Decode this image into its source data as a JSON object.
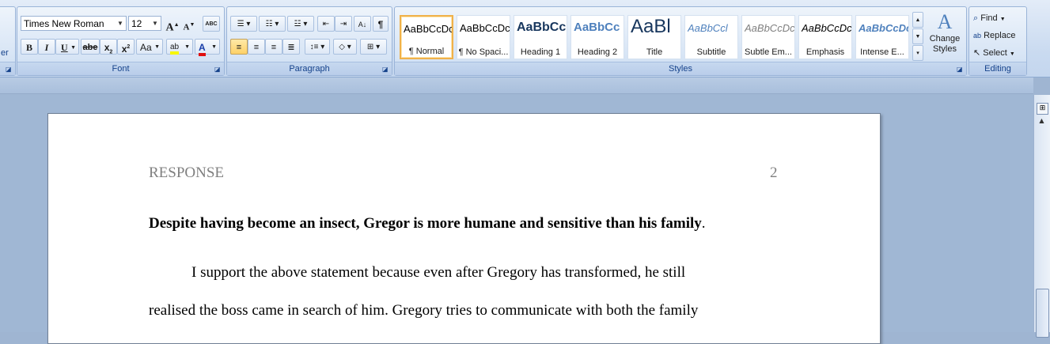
{
  "font_group": {
    "title": "Font",
    "font_name": "Times New Roman",
    "font_size": "12",
    "grow_label": "A",
    "shrink_label": "A",
    "clear_label": "ABC",
    "bold": "B",
    "italic": "I",
    "underline": "U",
    "strike": "abe",
    "subscript": "x",
    "superscript": "x",
    "change_case": "Aa",
    "highlight": "ab",
    "font_color": "A",
    "highlight_color": "#f7f700",
    "font_color_value": "#e01010"
  },
  "paragraph_group": {
    "title": "Paragraph",
    "show_marks": "¶"
  },
  "styles_group": {
    "title": "Styles",
    "tiles": [
      {
        "sample": "AaBbCcDc",
        "label": "¶ Normal",
        "selected": true
      },
      {
        "sample": "AaBbCcDc",
        "label": "¶ No Spaci..."
      },
      {
        "sample": "AaBbCc",
        "label": "Heading 1"
      },
      {
        "sample": "AaBbCc",
        "label": "Heading 2"
      },
      {
        "sample": "AaBl",
        "label": "Title"
      },
      {
        "sample": "AaBbCcl",
        "label": "Subtitle"
      },
      {
        "sample": "AaBbCcDc",
        "label": "Subtle Em..."
      },
      {
        "sample": "AaBbCcDc",
        "label": "Emphasis"
      },
      {
        "sample": "AaBbCcDc",
        "label": "Intense E..."
      }
    ],
    "change_styles": "Change Styles"
  },
  "editing_group": {
    "title": "Editing",
    "find": "Find",
    "replace": "Replace",
    "select": "Select"
  },
  "left_edge_label": "er",
  "document": {
    "header_left": "RESPONSE",
    "header_right": "2",
    "bold_sentence": "Despite having become an insect, Gregor is more humane and sensitive than his family",
    "bold_period": ".",
    "para_line1": "I support the above statement because even after Gregory has transformed, he still",
    "para_line2": "realised the boss came in search of him. Gregory tries to communicate with both the family"
  }
}
